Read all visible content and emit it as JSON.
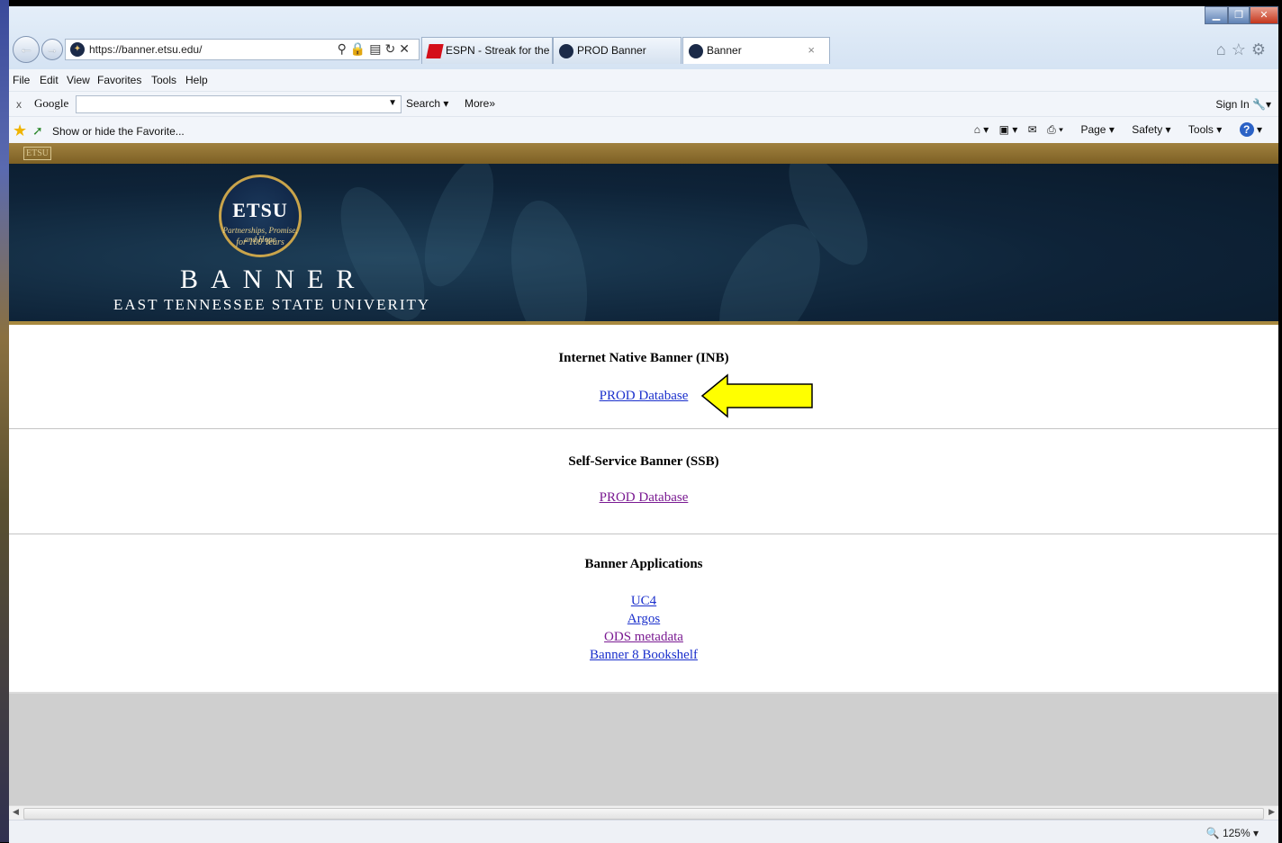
{
  "browser": {
    "url": "https://banner.etsu.edu/",
    "tabs": [
      {
        "label": "ESPN - Streak for the C..."
      },
      {
        "label": "PROD Banner"
      },
      {
        "label": "Banner"
      }
    ],
    "menu": [
      "File",
      "Edit",
      "View",
      "Favorites",
      "Tools",
      "Help"
    ],
    "google_toolbar": {
      "close": "x",
      "logo": "Google",
      "search_label": "Search",
      "more_label": "More»",
      "signin_label": "Sign In"
    },
    "favorites": {
      "label": "Show or hide the Favorite..."
    },
    "command_bar": {
      "page": "Page",
      "safety": "Safety",
      "tools": "Tools"
    },
    "status": {
      "zoom": "125%"
    }
  },
  "page": {
    "logo_small": "ETSU",
    "seal": {
      "name": "ETSU",
      "motto": "Partnerships, Promise, and Hope",
      "years": "for 100 Years"
    },
    "title": "BANNER",
    "subtitle": "EAST TENNESSEE STATE UNIVERITY",
    "sections": [
      {
        "heading": "Internet Native Banner (INB)",
        "links": [
          "PROD Database"
        ]
      },
      {
        "heading": "Self-Service Banner (SSB)",
        "links": [
          "PROD Database"
        ]
      },
      {
        "heading": "Banner Applications",
        "links": [
          "UC4",
          "Argos",
          "ODS metadata",
          "Banner 8 Bookshelf"
        ]
      }
    ]
  },
  "annotation": {
    "arrow_color": "#ffff00",
    "arrow_target": "PROD Database"
  }
}
